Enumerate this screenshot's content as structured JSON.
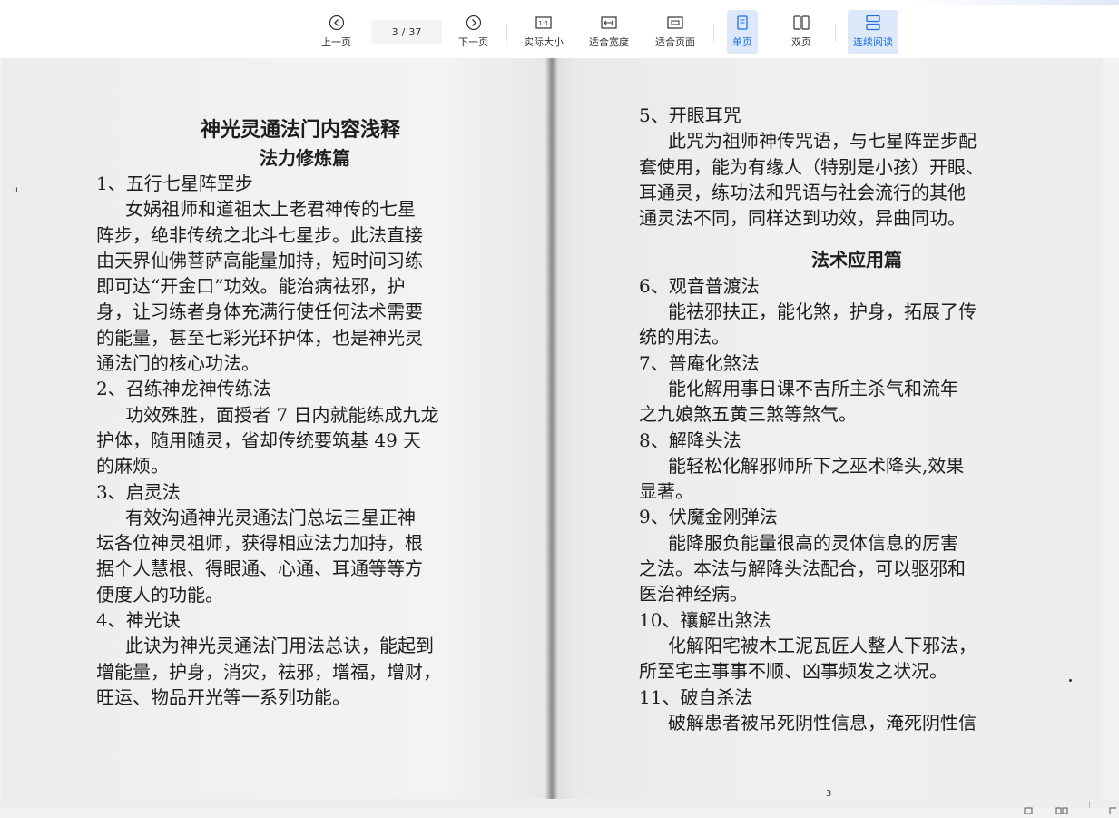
{
  "toolbar": {
    "prev": "上一页",
    "next": "下一页",
    "page_current": "3",
    "page_sep": "/",
    "page_total": "37",
    "actual_size": "实际大小",
    "actual_size_glyph": "1:1",
    "fit_width": "适合宽度",
    "fit_page": "适合页面",
    "single_page": "单页",
    "double_page": "双页",
    "continuous": "连续阅读",
    "accent_color": "#1d6fe0",
    "active_bg": "#dde9fb"
  },
  "document": {
    "left_mark": "ı",
    "page_number": "3",
    "left": {
      "title": "神光灵通法门内容浅释",
      "subtitle": "法力修炼篇",
      "lines": [
        "1、五行七星阵罡步",
        "女娲祖师和道祖太上老君神传的七星",
        "阵步，绝非传统之北斗七星步。此法直接",
        "由天界仙佛菩萨高能量加持，短时间习练",
        "即可达“开金口”功效。能治病祛邪，护",
        "身，让习练者身体充满行使任何法术需要",
        "的能量，甚至七彩光环护体，也是神光灵",
        "通法门的核心功法。",
        "2、召练神龙神传练法",
        "功效殊胜，面授者 7 日内就能练成九龙",
        "护体，随用随灵，省却传统要筑基 49 天",
        "的麻烦。",
        "3、启灵法",
        "有效沟通神光灵通法门总坛三星正神",
        "坛各位神灵祖师，获得相应法力加持，根",
        "据个人慧根、得眼通、心通、耳通等等方",
        "便度人的功能。",
        "4、神光诀",
        "此诀为神光灵通法门用法总诀，能起到",
        "增能量，护身，消灾，祛邪，增福，增财，",
        "旺运、物品开光等一系列功能。"
      ]
    },
    "right": {
      "lines_top": [
        "5、开眼耳咒",
        "此咒为祖师神传咒语，与七星阵罡步配",
        "套使用，能为有缘人（特别是小孩）开眼、",
        "耳通灵，练功法和咒语与社会流行的其他",
        "通灵法不同，同样达到功效，异曲同功。"
      ],
      "section": "法术应用篇",
      "lines_bottom": [
        "6、观音普渡法",
        "能祛邪扶正，能化煞，护身，拓展了传",
        "统的用法。",
        "7、普庵化煞法",
        "能化解用事日课不吉所主杀气和流年",
        "之九娘煞五黄三煞等煞气。",
        "8、解降头法",
        "能轻松化解邪师所下之巫术降头,效果",
        "显著。",
        "9、伏魔金刚弹法",
        "能降服负能量很高的灵体信息的厉害",
        "之法。本法与解降头法配合，可以驱邪和",
        "医治神经病。",
        "10、禳解出煞法",
        "化解阳宅被木工泥瓦匠人整人下邪法，",
        "所至宅主事事不顺、凶事频发之状况。",
        "11、破自杀法",
        "破解患者被吊死阴性信息，淹死阴性信"
      ]
    }
  }
}
